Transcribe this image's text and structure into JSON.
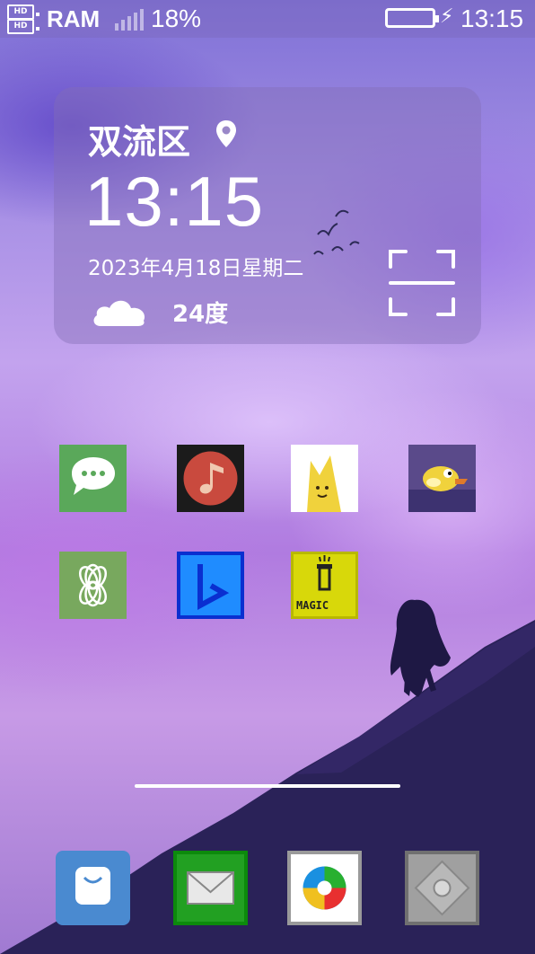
{
  "status_bar": {
    "hd_top": "HD",
    "hd_bottom": "HD",
    "ram_label": "RAM",
    "ram_percent": "18%",
    "time": "13:15",
    "battery_icon": "battery-charging-icon"
  },
  "widget": {
    "location": "双流区",
    "time": "13:15",
    "date": "2023年4月18日星期二",
    "temperature": "24度",
    "weather_icon": "cloud-icon",
    "scan_icon": "scan-icon"
  },
  "home_apps": [
    {
      "icon": "chat-bubble-icon",
      "color": "#5aa85a"
    },
    {
      "icon": "music-note-icon",
      "color": "#1b1b1b"
    },
    {
      "icon": "yellow-cat-icon",
      "color": "#ffffff"
    },
    {
      "icon": "flappy-bird-icon",
      "color": "#5a4a8a"
    },
    {
      "icon": "openai-flower-icon",
      "color": "#78a85e"
    },
    {
      "icon": "bing-b-icon",
      "color": "#1f8cff"
    },
    {
      "icon": "magic-flashlight-icon",
      "color": "#d8d80a"
    }
  ],
  "magic_app_text": "MAGIC",
  "dock_apps": [
    {
      "icon": "shopping-bag-icon",
      "color": "#4a8ad0"
    },
    {
      "icon": "mail-envelope-icon",
      "color": "#22a022"
    },
    {
      "icon": "color-wheel-icon",
      "color": "#ffffff"
    },
    {
      "icon": "settings-gear-icon",
      "color": "#a0a0a0"
    }
  ]
}
